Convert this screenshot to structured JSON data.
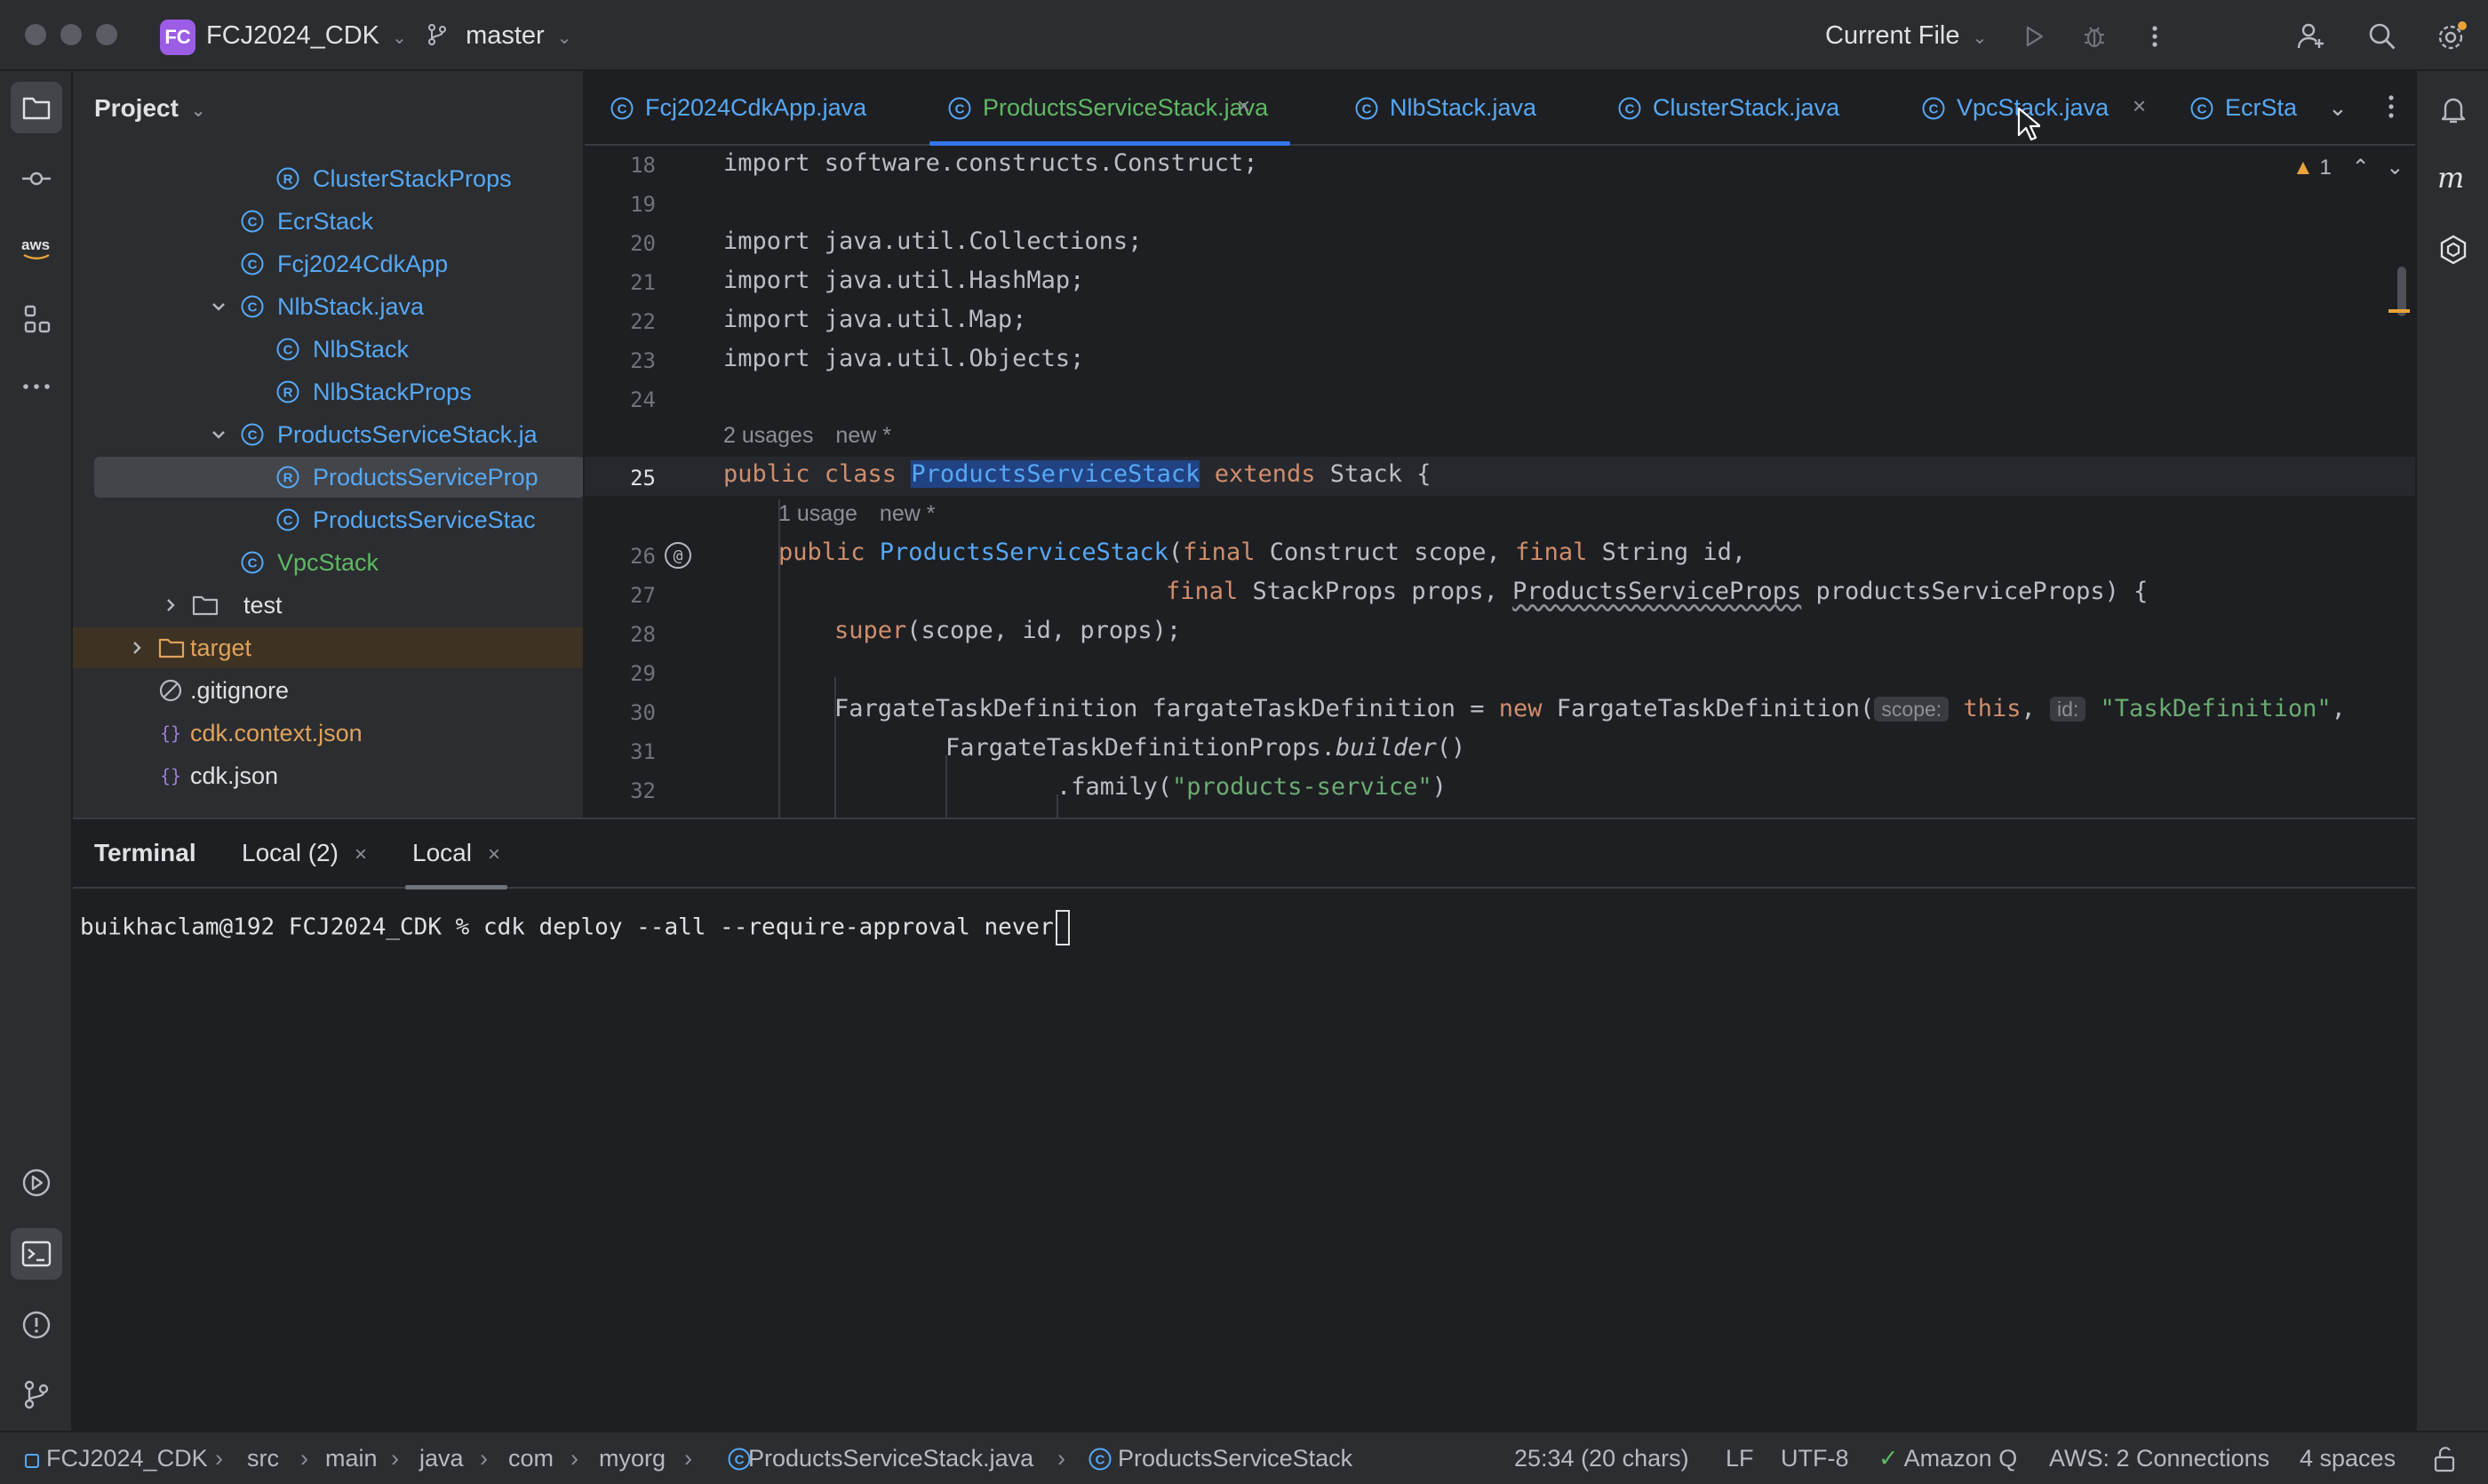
{
  "titlebar": {
    "project_badge": "FC",
    "project_name": "FCJ2024_CDK",
    "branch": "master",
    "run_config": "Current File"
  },
  "project_panel": {
    "title": "Project",
    "tree": [
      {
        "label": "ClusterStackProps",
        "kind": "record",
        "color": "#56a8f5"
      },
      {
        "label": "EcrStack",
        "kind": "class",
        "color": "#56a8f5"
      },
      {
        "label": "Fcj2024CdkApp",
        "kind": "class",
        "color": "#56a8f5"
      },
      {
        "label": "NlbStack.java",
        "kind": "class",
        "color": "#56a8f5",
        "expanded": true
      },
      {
        "label": "NlbStack",
        "kind": "class",
        "color": "#56a8f5"
      },
      {
        "label": "NlbStackProps",
        "kind": "record",
        "color": "#56a8f5"
      },
      {
        "label": "ProductsServiceStack.ja",
        "kind": "class",
        "color": "#56a8f5",
        "expanded": true
      },
      {
        "label": "ProductsServiceProp",
        "kind": "record",
        "color": "#56a8f5",
        "selected": true
      },
      {
        "label": "ProductsServiceStac",
        "kind": "class",
        "color": "#56a8f5"
      },
      {
        "label": "VpcStack",
        "kind": "class",
        "color": "#5fb865"
      },
      {
        "label": "test",
        "kind": "folder",
        "color": "#dfe1e5"
      },
      {
        "label": "target",
        "kind": "folder-excluded",
        "color": "#e0a25b"
      },
      {
        "label": ".gitignore",
        "kind": "ignore",
        "color": "#dfe1e5"
      },
      {
        "label": "cdk.context.json",
        "kind": "json",
        "color": "#e0a25b"
      },
      {
        "label": "cdk.json",
        "kind": "json",
        "color": "#dfe1e5"
      }
    ]
  },
  "editor": {
    "tabs": [
      {
        "label": "Fcj2024CdkApp.java",
        "color": "#56a8f5"
      },
      {
        "label": "ProductsServiceStack.java",
        "color": "#5fb865",
        "active": true,
        "close": "×"
      },
      {
        "label": "NlbStack.java",
        "color": "#56a8f5"
      },
      {
        "label": "ClusterStack.java",
        "color": "#56a8f5"
      },
      {
        "label": "VpcStack.java",
        "color": "#56a8f5",
        "close": "×"
      },
      {
        "label": "EcrSta",
        "color": "#56a8f5"
      }
    ],
    "warnings": "1",
    "line_numbers": {
      "l18": "18",
      "l19": "19",
      "l20": "20",
      "l21": "21",
      "l22": "22",
      "l23": "23",
      "l24": "24",
      "l25": "25",
      "l26": "26",
      "l27": "27",
      "l28": "28",
      "l29": "29",
      "l30": "30",
      "l31": "31",
      "l32": "32"
    },
    "lens": {
      "class_usages": "2 usages",
      "class_new": "new *",
      "ctor_usages": "1 usage",
      "ctor_new": "new *"
    },
    "code": {
      "l18": "import software.constructs.Construct;",
      "l20": "import java.util.Collections;",
      "l21": "import java.util.HashMap;",
      "l22": "import java.util.Map;",
      "l23": "import java.util.Objects;",
      "l25_kw": "public class ",
      "l25_name": "ProductsServiceStack",
      "l25_ext": " extends ",
      "l25_rest": "Stack {",
      "l26_kw": "public ",
      "l26_name": "ProductsServiceStack",
      "l26_p1": "(",
      "l26_final1": "final",
      "l26_p2": " Construct scope, ",
      "l26_final2": "final",
      "l26_p3": " String id,",
      "l27_final": "final",
      "l27_p1": " StackProps props, ",
      "l27_type": "ProductsServiceProps",
      "l27_p2": " productsServiceProps) {",
      "l28_super": "super",
      "l28_rest": "(scope, id, props);",
      "l30_p1": "FargateTaskDefinition fargateTaskDefinition = ",
      "l30_new": "new",
      "l30_p2": " FargateTaskDefinition(",
      "l30_hint1": "scope:",
      "l30_this": "this",
      "l30_comma": ", ",
      "l30_hint2": "id:",
      "l30_str": "\"TaskDefinition\"",
      "l30_end": ",",
      "l31_p1": "FargateTaskDefinitionProps.",
      "l31_builder": "builder",
      "l31_p2": "()",
      "l32_p1": ".family(",
      "l32_str": "\"products-service\"",
      "l32_p2": ")"
    }
  },
  "terminal": {
    "title": "Terminal",
    "tabs": [
      {
        "label": "Local (2)",
        "close": "×"
      },
      {
        "label": "Local",
        "close": "×",
        "active": true
      }
    ],
    "prompt": "buikhaclam@192 FCJ2024_CDK % cdk deploy --all --require-approval never"
  },
  "statusbar": {
    "breadcrumbs": [
      "FCJ2024_CDK",
      "src",
      "main",
      "java",
      "com",
      "myorg",
      "ProductsServiceStack.java",
      "ProductsServiceStack"
    ],
    "position": "25:34 (20 chars)",
    "line_ending": "LF",
    "encoding": "UTF-8",
    "amazon_q": "Amazon Q",
    "aws": "AWS: 2 Connections",
    "indent": "4 spaces"
  },
  "colors": {
    "accent": "#3574f0",
    "class_blue": "#56a8f5",
    "vcs_green": "#5fb865",
    "excluded_orange": "#e0a25b",
    "keyword": "#cf8e6d",
    "string": "#6aab73"
  },
  "icons": [
    "folder-icon",
    "commit-icon",
    "aws-icon",
    "structure-icon",
    "more-icon",
    "services-icon",
    "terminal-icon",
    "problems-icon",
    "git-icon",
    "notifications-icon",
    "ai-assistant-icon",
    "amazon-q-icon",
    "run-icon",
    "debug-icon",
    "add-user-icon",
    "search-icon",
    "settings-icon"
  ]
}
